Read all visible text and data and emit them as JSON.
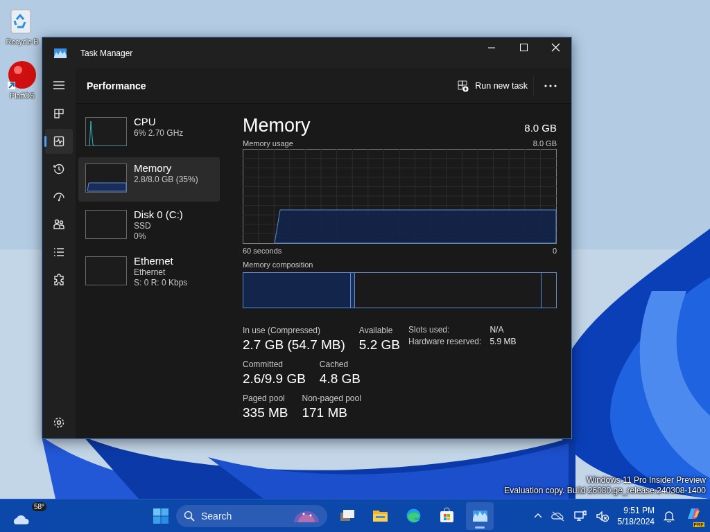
{
  "desktop": {
    "icons": [
      {
        "kind": "recycle",
        "label": "Recycle B"
      },
      {
        "kind": "app",
        "label": "PlatfOS"
      }
    ],
    "watermark": [
      "Windows 11 Pro Insider Preview",
      "Evaluation copy. Build 26080.ge_release.240308-1400"
    ]
  },
  "window": {
    "title": "Task Manager"
  },
  "nav": {
    "items": [
      {
        "kind": "processes",
        "selected": false
      },
      {
        "kind": "performance",
        "selected": true
      },
      {
        "kind": "history",
        "selected": false
      },
      {
        "kind": "startup",
        "selected": false
      },
      {
        "kind": "users",
        "selected": false
      },
      {
        "kind": "details",
        "selected": false
      },
      {
        "kind": "services",
        "selected": false
      }
    ]
  },
  "page": {
    "title": "Performance",
    "run_task": "Run new task"
  },
  "devices": [
    {
      "kind": "cpu",
      "name": "CPU",
      "lines": [
        "6% 2.70 GHz"
      ],
      "selected": false
    },
    {
      "kind": "memory",
      "name": "Memory",
      "lines": [
        "2.8/8.0 GB (35%)"
      ],
      "selected": true
    },
    {
      "kind": "disk",
      "name": "Disk 0 (C:)",
      "lines": [
        "SSD",
        "0%"
      ],
      "selected": false
    },
    {
      "kind": "ethernet",
      "name": "Ethernet",
      "lines": [
        "Ethernet",
        "S: 0 R: 0 Kbps"
      ],
      "selected": false
    }
  ],
  "detail": {
    "title": "Memory",
    "total": "8.0 GB",
    "usage_label": "Memory usage",
    "usage_max": "8.0 GB",
    "time_start": "60 seconds",
    "time_end": "0",
    "composition_label": "Memory composition",
    "stat_rows": [
      [
        {
          "label": "In use (Compressed)",
          "value": "2.7 GB (54.7 MB)"
        },
        {
          "label": "Available",
          "value": "5.2 GB"
        }
      ],
      [
        {
          "label": "Committed",
          "value": "2.6/9.9 GB"
        },
        {
          "label": "Cached",
          "value": "4.8 GB"
        }
      ],
      [
        {
          "label": "Paged pool",
          "value": "335 MB"
        },
        {
          "label": "Non-paged pool",
          "value": "171 MB"
        }
      ]
    ],
    "info": [
      {
        "label": "Slots used:",
        "value": "N/A"
      },
      {
        "label": "Hardware reserved:",
        "value": "5.9 MB"
      }
    ]
  },
  "taskbar": {
    "weather": "58°",
    "search_placeholder": "Search",
    "apps": [
      {
        "kind": "files",
        "selected": false
      },
      {
        "kind": "explorer",
        "selected": false
      },
      {
        "kind": "edge",
        "selected": false
      },
      {
        "kind": "store",
        "selected": false
      },
      {
        "kind": "taskmgr",
        "selected": true
      }
    ],
    "time": "9:51 PM",
    "date": "5/18/2024",
    "badge": "PRE"
  }
}
